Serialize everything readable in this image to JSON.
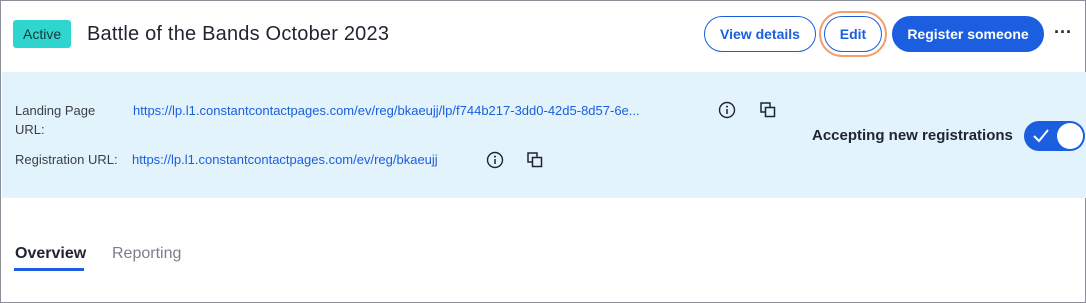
{
  "header": {
    "status_badge": "Active",
    "title": "Battle of the Bands October 2023",
    "view_details_label": "View details",
    "edit_label": "Edit",
    "register_label": "Register someone",
    "more_label": "···"
  },
  "urls": {
    "landing_label": "Landing Page URL:",
    "landing_url": "https://lp.l1.constantcontactpages.com/ev/reg/bkaeujj/lp/f744b217-3dd0-42d5-8d57-6e...",
    "registration_label": "Registration URL:",
    "registration_url": "https://lp.l1.constantcontactpages.com/ev/reg/bkaeujj"
  },
  "registration_toggle": {
    "label": "Accepting new registrations",
    "enabled": true
  },
  "tabs": [
    {
      "label": "Overview",
      "active": true
    },
    {
      "label": "Reporting",
      "active": false
    }
  ],
  "colors": {
    "accent": "#1b5ee0",
    "badge": "#2fd6cf",
    "band": "#e3f3fb",
    "focus_ring": "#f2a06b"
  },
  "icons": [
    "info-icon",
    "copy-icon",
    "check-icon",
    "more-icon"
  ]
}
